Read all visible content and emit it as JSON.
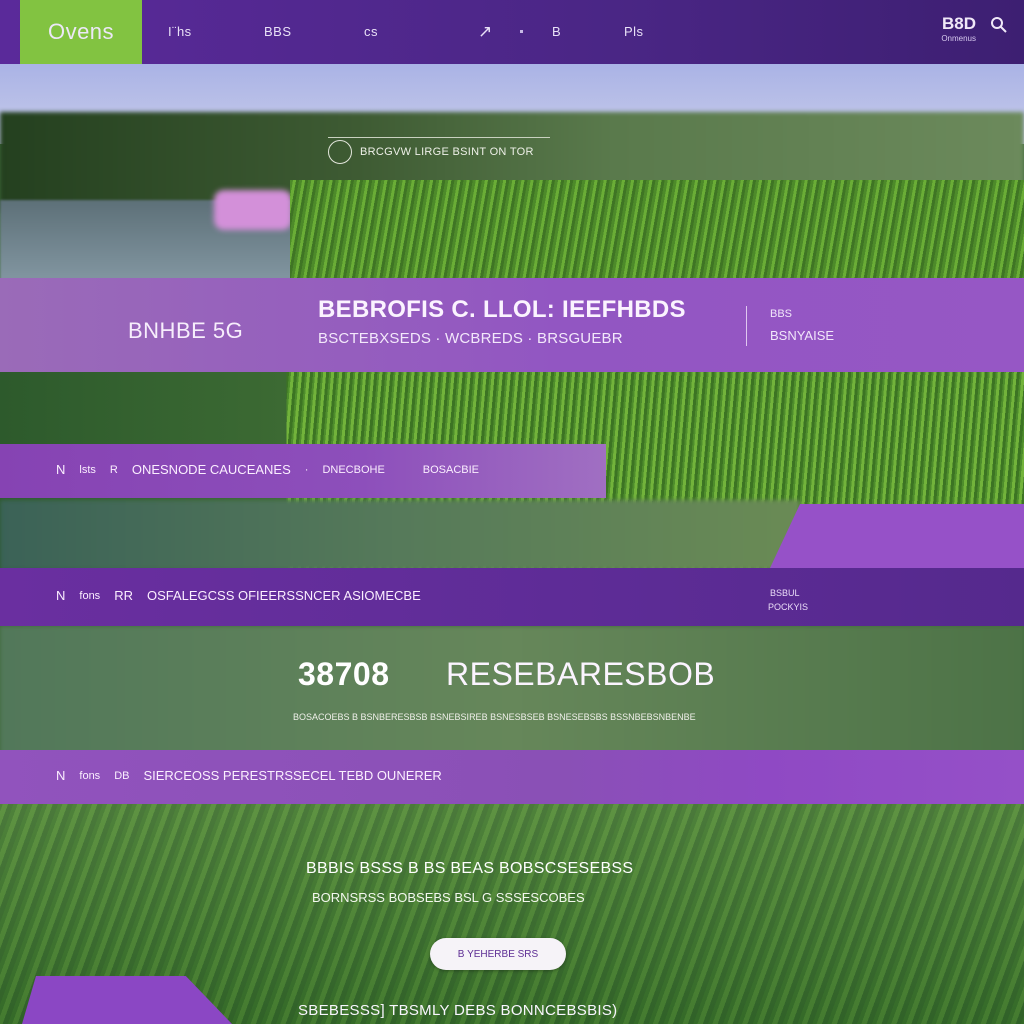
{
  "nav": {
    "logo": "Ovens",
    "items": [
      "I¨hs",
      "BBS",
      "cs"
    ],
    "icon_item": "↗",
    "items2": [
      "B",
      "Pls"
    ],
    "brand": "B8D",
    "brand_sub": "Onmenus",
    "brand_icon": "search-icon"
  },
  "hero": {
    "tag": "BRCGVW LIRGE BSINT ON TOR"
  },
  "band1": {
    "left_label": "BNHBE 5G",
    "title": "BEBROFIS C.  LLOL: IEEFHBDS",
    "subtitle": "BSCTEBXSEDS  ·  WCBREDS  ·  BRSGUEBR",
    "right_top": "BBS",
    "right_bottom": "BSNYAISE"
  },
  "band2": {
    "num": "N",
    "items": [
      "lsts",
      "R",
      "ONESNODE CAUCEANES",
      "·",
      "DNECBOHE",
      "BOSACBIE"
    ]
  },
  "band3": {
    "num": "N",
    "items": [
      "fons",
      "RR",
      "OSFALEGCSS OFIEERSSNCER ASIOMECBE"
    ],
    "right_top": "BSBUL",
    "right_bottom": "POCKYIS"
  },
  "stats": {
    "number": "38708",
    "label": "RESEBARESBOB",
    "sub": "BOSACOEBS B BSNBERESBSB BSNEBSIREB BSNESBSEB BSNESEBSBS BSSNBEBSNBENBE"
  },
  "band4": {
    "num": "N",
    "items": [
      "fons",
      "DB",
      "SIERCEOSS PERESTRSSECEL TEBD OUNERER"
    ]
  },
  "cta": {
    "line1": "BBBIS BSSS  B BS  BEAS BOBSCSESEBSS",
    "line2": "BORNSRSS BOBSEBS BSL G SSSESCOBES",
    "button": "B YEHERBE SRS",
    "footer": "SBEBESSS]   TBSMLY DEBS   BONNCEBSBIS)"
  },
  "colors": {
    "nav": "#4a2685",
    "logo_bg": "#82c341",
    "band_purple": "#8d4fbb",
    "band_dark": "#5d2c96"
  }
}
